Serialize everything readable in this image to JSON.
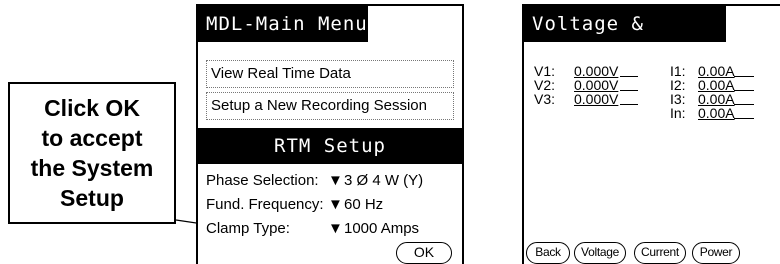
{
  "callout": {
    "lines": [
      "Click OK",
      "to accept",
      "the System",
      "Setup"
    ]
  },
  "screen_main": {
    "title": "MDL-Main Menu",
    "menu_items": [
      "View Real Time Data",
      "Setup a New Recording Session"
    ],
    "section_title": "RTM Setup",
    "settings": [
      {
        "label": "Phase Selection:",
        "value": "3 Ø 4 W (Y)"
      },
      {
        "label": "Fund. Frequency:",
        "value": "60 Hz"
      },
      {
        "label": "Clamp Type:",
        "value": "1000 Amps"
      }
    ],
    "dropdown_glyph": "▼",
    "ok_label": "OK"
  },
  "screen_vc": {
    "title": "Voltage & Current",
    "voltages": [
      {
        "label": "V1:",
        "value": "0.000V"
      },
      {
        "label": "V2:",
        "value": "0.000V"
      },
      {
        "label": "V3:",
        "value": "0.000V"
      }
    ],
    "currents": [
      {
        "label": "I1:",
        "value": "0.00A"
      },
      {
        "label": "I2:",
        "value": "0.00A"
      },
      {
        "label": "I3:",
        "value": "0.00A"
      },
      {
        "label": "In:",
        "value": "0.00A"
      }
    ],
    "buttons": [
      "Back",
      "Voltage",
      "Current",
      "Power"
    ]
  }
}
